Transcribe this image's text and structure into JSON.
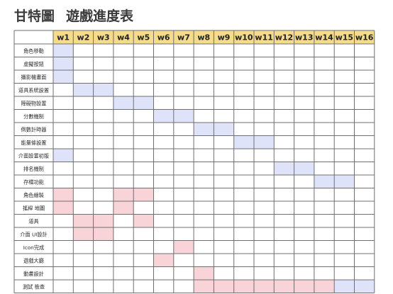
{
  "header": {
    "title": "甘特圖",
    "subtitle": "遊戲進度表"
  },
  "chart_data": {
    "type": "gantt",
    "title": "甘特圖 遊戲進度表",
    "columns": [
      "w1",
      "w2",
      "w3",
      "w4",
      "w5",
      "w6",
      "w7",
      "w8",
      "w9",
      "w10",
      "w11",
      "w12",
      "w13",
      "w14",
      "w15",
      "w16"
    ],
    "colors": {
      "header_fill": "#f5dc8a",
      "blue": "#dfe3fa",
      "pink": "#f8d3d8",
      "grid": "#6f6f6f",
      "label_text": "#2b2b2b"
    },
    "tasks": [
      {
        "label": "角色移動",
        "color": "blue",
        "weeks": [
          1
        ]
      },
      {
        "label": "虛擬按鈕",
        "color": "blue",
        "weeks": [
          1
        ]
      },
      {
        "label": "攝影機畫面",
        "color": "blue",
        "weeks": [
          1
        ]
      },
      {
        "label": "道具系統設置",
        "color": "blue",
        "weeks": [
          2,
          3
        ]
      },
      {
        "label": "障礙物設置",
        "color": "blue",
        "weeks": [
          4,
          5
        ]
      },
      {
        "label": "分數機制",
        "color": "blue",
        "weeks": [
          6,
          7
        ]
      },
      {
        "label": "倒數計時器",
        "color": "blue",
        "weeks": [
          8,
          9
        ]
      },
      {
        "label": "能量條設置",
        "color": "blue",
        "weeks": [
          10,
          11
        ]
      },
      {
        "label": "介面設置初版",
        "color": "blue",
        "weeks": [
          1
        ]
      },
      {
        "label": "排名機制",
        "color": "blue",
        "weeks": [
          12,
          13
        ]
      },
      {
        "label": "存檔功能",
        "color": "blue",
        "weeks": [
          14,
          15
        ]
      },
      {
        "label": "角色繪製",
        "color": "pink",
        "weeks": [
          1,
          4,
          5
        ]
      },
      {
        "label": "搖桿 地圖",
        "color": "pink",
        "weeks": [
          1,
          4
        ]
      },
      {
        "label": "道具",
        "color": "pink",
        "weeks": [
          2,
          3,
          5
        ]
      },
      {
        "label": "介面 UI設計",
        "color": "pink",
        "weeks": [
          2,
          3
        ]
      },
      {
        "label": "Icon完成",
        "color": "pink",
        "weeks": [
          7
        ]
      },
      {
        "label": "遊戲大廳",
        "color": "pink",
        "weeks": [
          6
        ]
      },
      {
        "label": "動畫設計",
        "color": "pink",
        "weeks": [
          8
        ]
      },
      {
        "label": "測試 檢查",
        "color": "mixed",
        "weeks": [
          8,
          9,
          10,
          11,
          12,
          13,
          14,
          15,
          16
        ],
        "pink_weeks": [
          8,
          9,
          10,
          11,
          12,
          13,
          14
        ],
        "blue_weeks": [
          15,
          16
        ]
      }
    ]
  }
}
